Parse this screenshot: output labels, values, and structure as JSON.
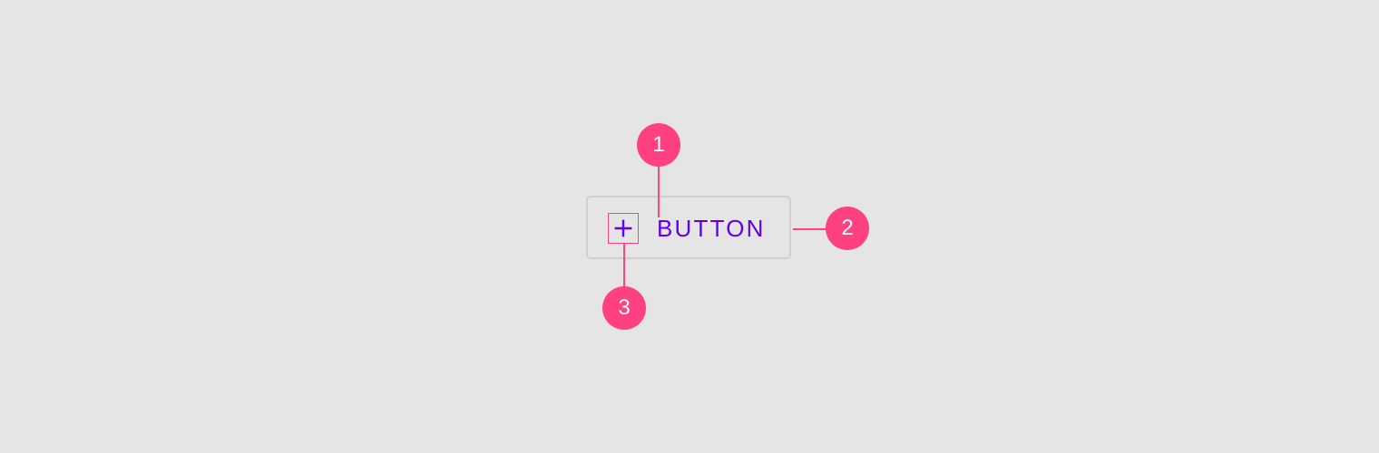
{
  "button": {
    "label": "BUTTON",
    "icon": "plus-icon"
  },
  "callouts": [
    {
      "number": "1"
    },
    {
      "number": "2"
    },
    {
      "number": "3"
    }
  ],
  "colors": {
    "background": "#e5e5e5",
    "button_outline": "#cfcfcf",
    "button_text": "#6200ee",
    "callout": "#ff4081",
    "callout_text": "#ffffff"
  }
}
